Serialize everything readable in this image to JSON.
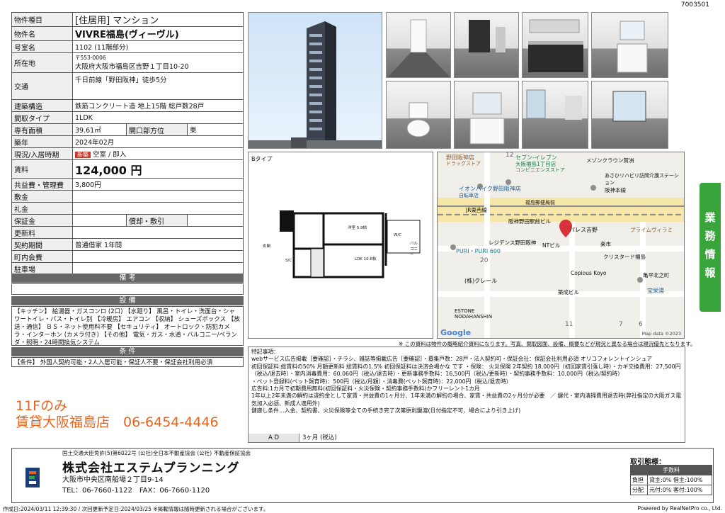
{
  "doc_id": "7003501",
  "property": {
    "rows": [
      {
        "key": "物件種目",
        "value": "[住居用] マンション"
      },
      {
        "key": "物件名",
        "value": "VIVRE福島(ヴィーヴル)"
      },
      {
        "key": "号室名",
        "value": "1102 (11階部分)"
      },
      {
        "key": "所在地",
        "zip": "〒553-0006",
        "value": "大阪府大阪市福島区吉野１丁目10-20"
      },
      {
        "key": "交通",
        "value": "千日前線「野田阪神」徒歩5分"
      },
      {
        "key": "建築構造",
        "value": "鉄筋コンクリート造 地上15階 総戸数28戸"
      },
      {
        "key": "間取タイプ",
        "value": "1LDK"
      },
      {
        "key": "専有面積",
        "value": "39.61㎡",
        "key2": "開口部方位",
        "value2": "東"
      },
      {
        "key": "築年",
        "value": "2024年02月"
      },
      {
        "key": "現況/入居時期",
        "badge": "新築",
        "value": "空室 / 即入"
      },
      {
        "key": "賃料",
        "value": "124,000 円"
      },
      {
        "key": "共益費・管理費",
        "value": "3,800円"
      },
      {
        "key": "敷金",
        "value": ""
      },
      {
        "key": "礼金",
        "value": ""
      },
      {
        "key": "保証金",
        "value": "",
        "key2": "償却・敷引",
        "value2": ""
      },
      {
        "key": "更新料",
        "value": ""
      },
      {
        "key": "契約期間",
        "value": "普通借家 1年間"
      },
      {
        "key": "町内会費",
        "value": ""
      },
      {
        "key": "駐車場",
        "value": ""
      }
    ]
  },
  "sections": {
    "remarks": "備 考",
    "equipment": "設 備",
    "conditions": "条 件"
  },
  "equipment_text": "【キッチン】 給湯器・ガスコンロ (2口) 【水廻り】 風呂・トイレ・洗面台・シャワートイレ・バス・トイレ別 【冷暖房】 エアコン 【収納】 シューズボックス 【放送・通信】 ＢＳ・ネット使用料不要 【セキュリティ】 オートロック・防犯カメラ・インターホン (カメラ付き) 【その他】 電気・ガス・水道・バルコニー/ベランダ・照明・24時間換気システム",
  "conditions_text": "【条件】 外国人契約可能・2人入居可能・保証人不要・保証会社利用必須",
  "promo": {
    "line1": "11Fのみ",
    "line2": "賃貸大阪福島店　06-6454-4446"
  },
  "plan": {
    "type_label": "Bタイプ",
    "rooms": [
      "洋室 5.9帖",
      "LDK 10.6帖",
      "W/C",
      "玄関",
      "S/C",
      "バルコニー"
    ]
  },
  "map": {
    "labels": [
      "野田阪神店",
      "ドラッグストア",
      "セブン-イレブン",
      "大阪福島1丁目店",
      "コンビニエンスストア",
      "イオンバイク野田阪神店",
      "自転車店",
      "阪神本線",
      "JR東西線",
      "福島郵便局前",
      "阪神野田駅前ビル",
      "パレス吉野",
      "レジデンス野田阪神",
      "プライムヴィラミ",
      "PURI・PURI 600",
      "NTビル",
      "楽市",
      "クリスタード福島",
      "Copious Koyo",
      "(株)クレール",
      "築成ビル",
      "宝栄湯",
      "亀平北之町",
      "ESTONE NODAHANSHIN",
      "メゾンクラウン賀洲",
      "あさひリハビリ訪問介護ステーション",
      "20",
      "11",
      "7",
      "6",
      "12"
    ],
    "google": "Google",
    "attribution": "Map data ©2023"
  },
  "note_small": "※ この資料は物件の概略紹介資料になります。写真、間取図面、設備、概要などが現況と異なる場合は現況優先となります。",
  "notes": {
    "title": "特記事項：",
    "lines": [
      "webサービス広告掲載［要確認］・チラシ、雑誌等掲載広告［要確認］・募集戸数：28戸・法人契約可・保証会社：保証会社利用必須 オリコフォレントインシュア",
      "初回保証料:総賃料の50% 月額更新料 総賃料の1.5% 初回保証料は決済会場かな です ・保険： 火災保険 2年契約 18,000円（初回家賃引落し時）・カギ交換費用：27,500円（税込/退去時）・室内消毒費用：60,060円（税込/退去時）・更新事務手数料：16,500円（税込/更新時）・契約事務手数料：10,000円（税込/契約時）",
      "・ペット登録料(ペット飼育時)：500円（税込/月額）・消毒費(ペット飼育時)：22,000円（税込/退去時）",
      "広告料:1カ月で初期費用無料(初回保証料・火災保険・契約事務手数料)かフリーレント1カ月",
      "1年以上2年未満の解約は違約金として家賃・共益費の1ヶ月分、1年未満の解約の場合、家賃・共益費の2ヶ月分が必要　／ 鍵代・室内清掃費用退去時(弊社指定の大阪ガス電気加入必須、新成人適用外)",
      "健康し条件…入金、契約書、火災保険等全ての手続き完了次第原則鍵渡(日付指定不可、場合により引き上げ)"
    ]
  },
  "ad": {
    "label": "A D",
    "value": "3ヶ月 (税込)"
  },
  "sidetab": [
    "業",
    "務",
    "情",
    "報"
  ],
  "company": {
    "license": "国土交通大臣免許(5)第6022号 (公社)全日本不動産協会 (公社) 不動産保証協会",
    "name": "株式会社エステムプランニング",
    "address": "大阪市中央区南船場２丁目9-14",
    "tel": "TEL：06-7660-1122　FAX：06-7660-1120"
  },
  "fee": {
    "heading": "取引態様：",
    "header": "手数料",
    "rows": [
      {
        "k": "負担",
        "v": "貸主:0% 借主:100%"
      },
      {
        "k": "分配",
        "v": "元付:0% 客付:100%"
      }
    ]
  },
  "footer": {
    "left": "作成日:2024/03/11 12:39:30 / 次回更新予定日:2024/03/25 ※掲載情報は随時更新される場合がございます。",
    "right": "Powered by RealNetPro co., Ltd."
  },
  "colors": {
    "accent_orange": "#e8641e",
    "tab_green": "#3aa43c",
    "badge_red": "#c0392b",
    "map_pin": "#d9323a"
  }
}
